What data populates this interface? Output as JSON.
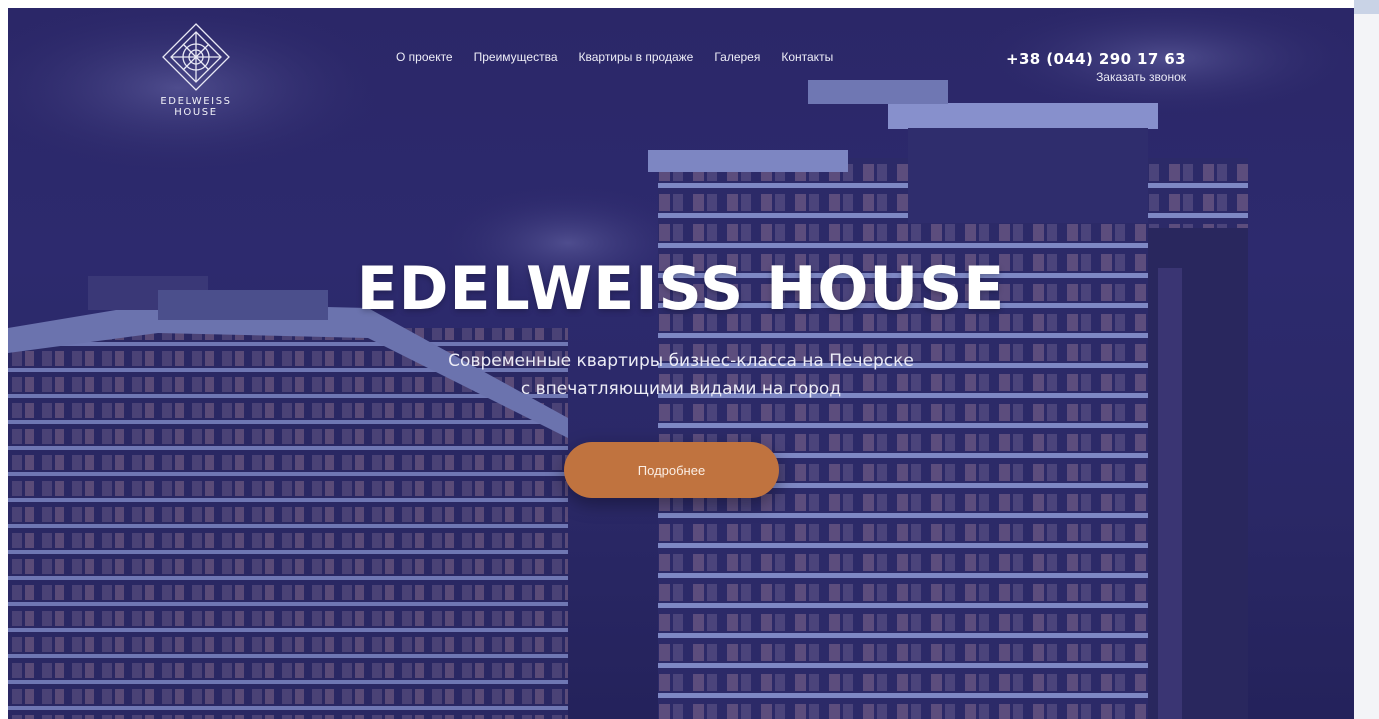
{
  "brand": {
    "line1": "EDELWEISS",
    "line2": "HOUSE",
    "logo_icon": "edelweiss-flower-diamond-icon"
  },
  "nav": {
    "items": [
      {
        "label": "О проекте"
      },
      {
        "label": "Преимущества"
      },
      {
        "label": "Квартиры в продаже"
      },
      {
        "label": "Галерея"
      },
      {
        "label": "Контакты"
      }
    ]
  },
  "contact": {
    "phone": "+38 (044) 290 17 63",
    "callback_label": "Заказать звонок"
  },
  "hero": {
    "title": "EDELWEISS HOUSE",
    "subtitle_line1": "Современные квартиры бизнес-класса на Печерске",
    "subtitle_line2": "с впечатляющими видами на город",
    "cta_label": "Подробнее"
  },
  "colors": {
    "overlay": "#2b2768",
    "accent": "#c0733f",
    "text": "#ffffff"
  }
}
